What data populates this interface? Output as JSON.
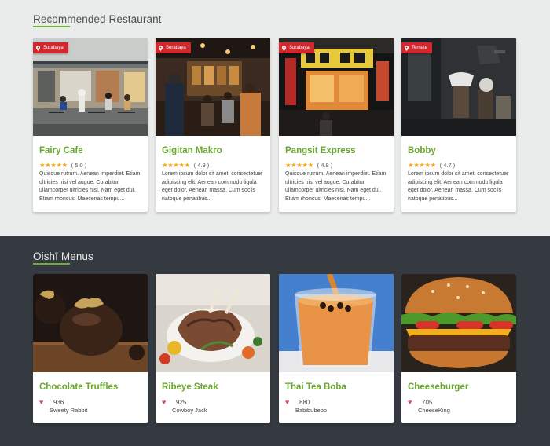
{
  "recommended": {
    "title": "Recommended Restaurant",
    "restaurants": [
      {
        "name": "Fairy Cafe",
        "location": "Surabaya",
        "stars": "★★★★★",
        "rating": "( 5.0 )",
        "desc": "Quisque rutrum. Aenean imperdiet. Etiam ultricies nisi vel augue. Curabitur ullamcorper ultricies nisi. Nam eget dui. Etiam rhoncus. Maecenas tempu..."
      },
      {
        "name": "Gigitan Makro",
        "location": "Surabaya",
        "stars": "★★★★★",
        "rating": "( 4.9 )",
        "desc": "Lorem ipsum dolor sit amet, consectetuer adipiscing elit. Aenean commodo ligula eget dolor. Aenean massa. Cum sociis natoque penatibus..."
      },
      {
        "name": "Pangsit Express",
        "location": "Surabaya",
        "stars": "★★★★★",
        "rating": "( 4.8 )",
        "desc": "Quisque rutrum. Aenean imperdiet. Etiam ultricies nisi vel augue. Curabitur ullamcorper ultricies nisi. Nam eget dui. Etiam rhoncus. Maecenas tempu..."
      },
      {
        "name": "Bobby",
        "location": "Ternate",
        "stars": "★★★★★",
        "rating": "( 4.7 )",
        "desc": "Lorem ipsum dolor sit amet, consectetuer adipiscing elit. Aenean commodo ligula eget dolor. Aenean massa. Cum sociis natoque penatibus..."
      }
    ]
  },
  "menus": {
    "title": "Oishī Menus",
    "items": [
      {
        "name": "Chocolate Truffles",
        "likes": "936",
        "author": "Sweety Rabbit"
      },
      {
        "name": "Ribeye Steak",
        "likes": "925",
        "author": "Cowboy Jack"
      },
      {
        "name": "Thai Tea Boba",
        "likes": "880",
        "author": "Babibubebo"
      },
      {
        "name": "Cheeseburger",
        "likes": "705",
        "author": "CheeseKing"
      }
    ]
  },
  "icons": {
    "location": "map-pin-icon",
    "like": "heart-icon",
    "rating": "star-icon"
  },
  "colors": {
    "accent": "#6ba630",
    "badge": "#d0282e",
    "star": "#f3a51b",
    "heart": "#e0485c",
    "dark_section": "#343a40",
    "light_section": "#e9eceb"
  }
}
